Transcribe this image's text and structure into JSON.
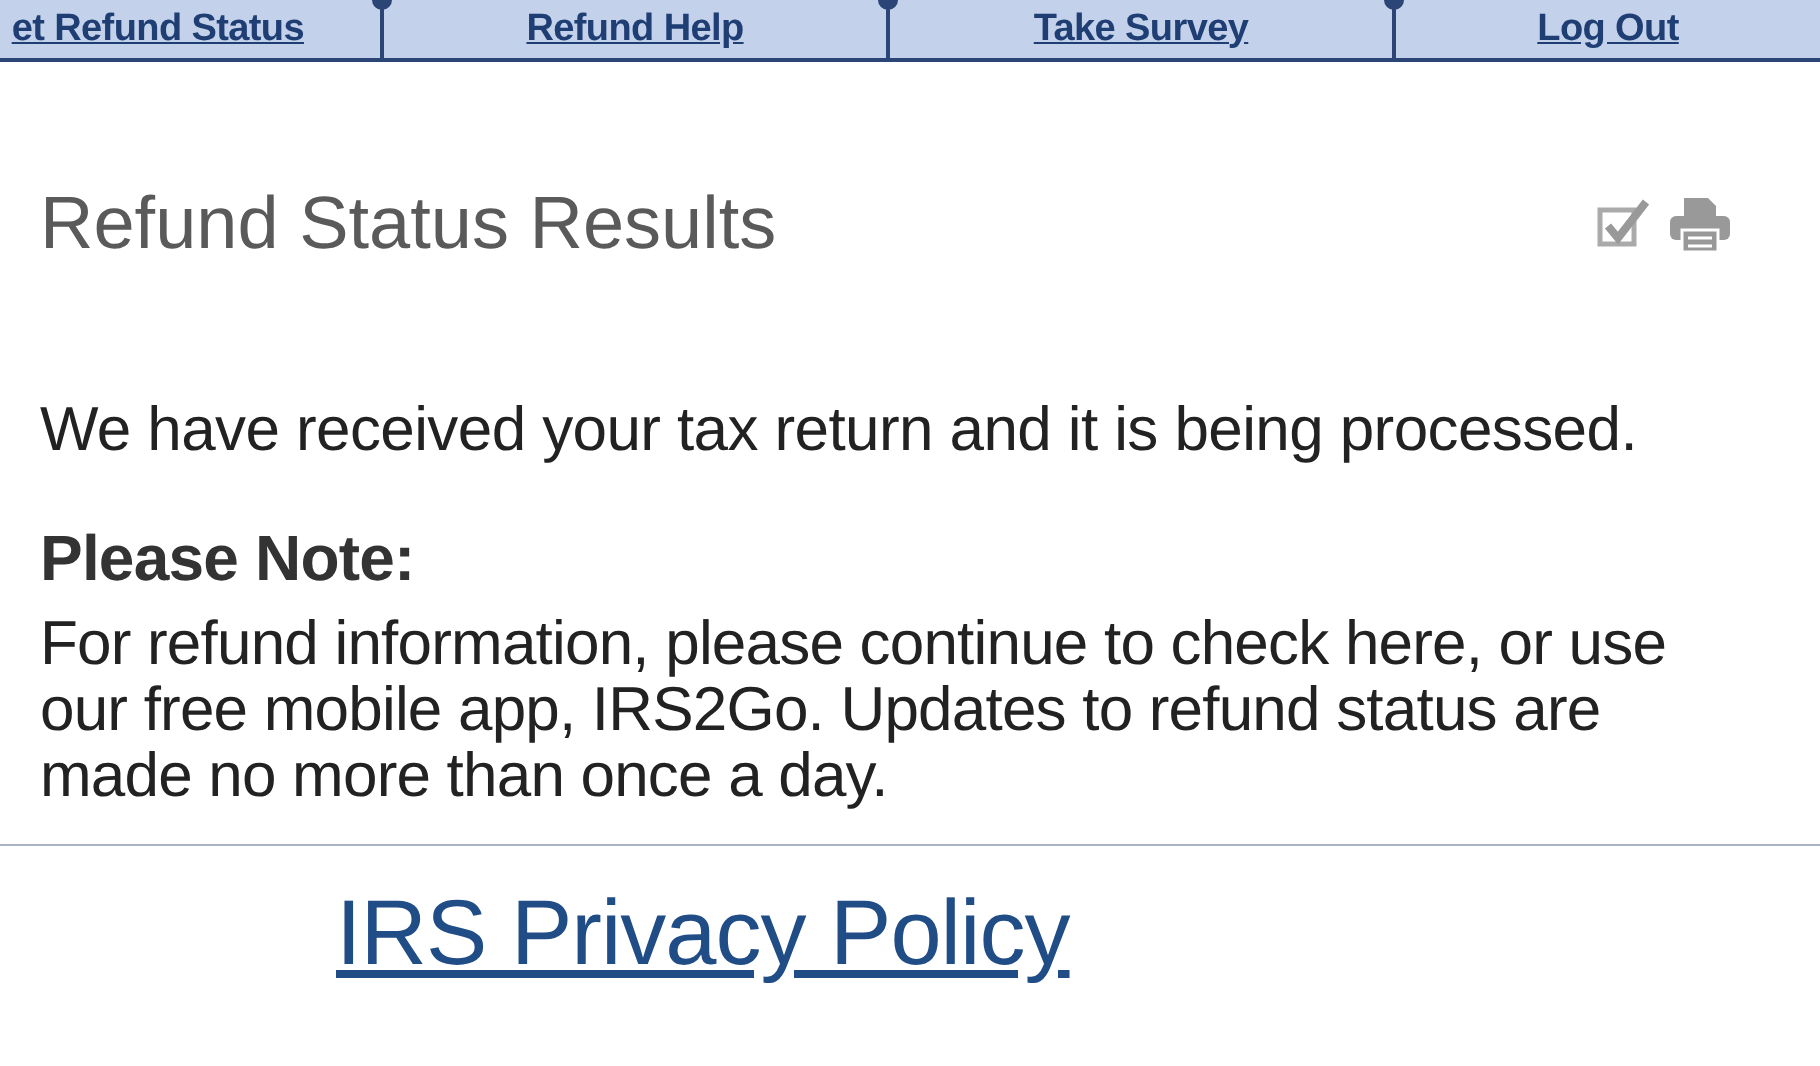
{
  "nav": {
    "tabs": [
      {
        "label": "et Refund Status"
      },
      {
        "label": "Refund Help"
      },
      {
        "label": "Take Survey"
      },
      {
        "label": "Log Out"
      }
    ]
  },
  "title": "Refund Status Results",
  "status_message": "We have received your tax return and it is being processed.",
  "note": {
    "heading": "Please Note:",
    "text": "For refund information, please continue to check here, or use our free mobile app, IRS2Go. Updates to refund status are made no more than once a day."
  },
  "footer_link": "IRS Privacy Policy"
}
